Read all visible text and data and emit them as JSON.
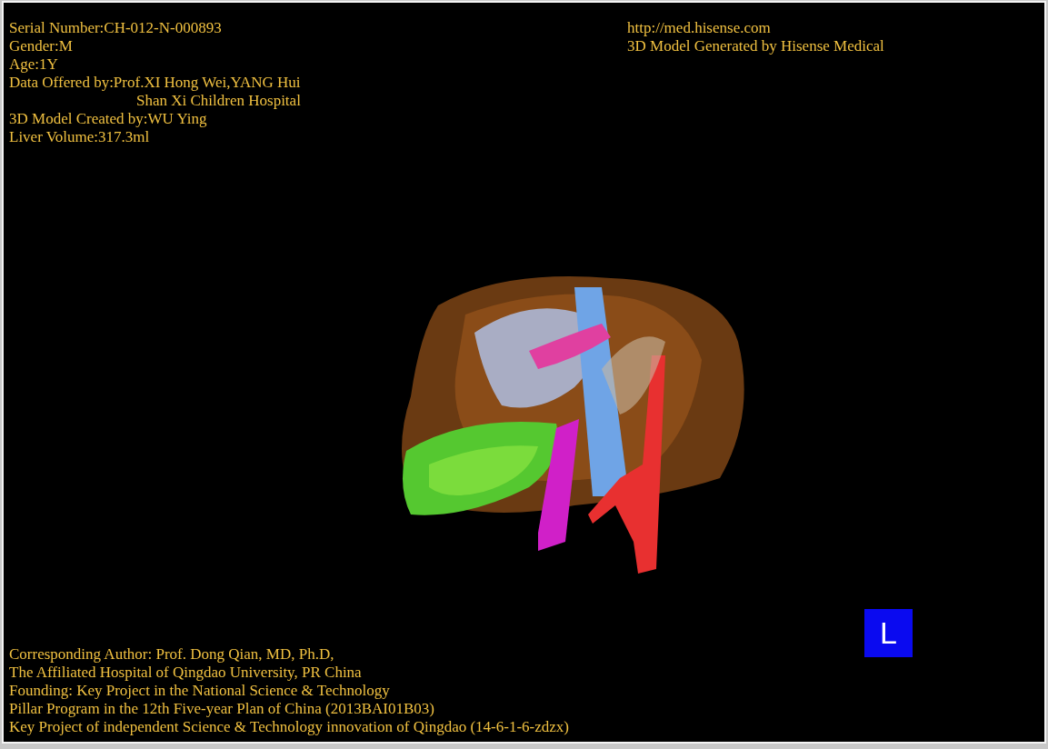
{
  "info_left": [
    {
      "kind": "line",
      "text": "Serial Number:CH-012-N-000893"
    },
    {
      "kind": "line",
      "text": "Gender:M"
    },
    {
      "kind": "line",
      "text": "Age:1Y"
    },
    {
      "kind": "line",
      "text": "Data Offered by:Prof.XI Hong Wei,YANG Hui"
    },
    {
      "kind": "indent",
      "text": "Shan Xi Children Hospital"
    },
    {
      "kind": "line",
      "text": "3D Model Created by:WU Ying"
    },
    {
      "kind": "line",
      "text": "Liver Volume:317.3ml"
    }
  ],
  "info_right": [
    "http://med.hisense.com",
    "3D Model Generated by Hisense Medical"
  ],
  "orientation_marker": "L",
  "footer": [
    "Corresponding Author: Prof. Dong Qian, MD, Ph.D,",
    "The Affiliated Hospital of Qingdao University, PR China",
    "Founding: Key Project in the National Science & Technology",
    "Pillar Program in the 12th Five-year Plan of China (2013BAI01B03)",
    "Key Project of independent Science & Technology innovation of Qingdao (14-6-1-6-zdzx)"
  ]
}
